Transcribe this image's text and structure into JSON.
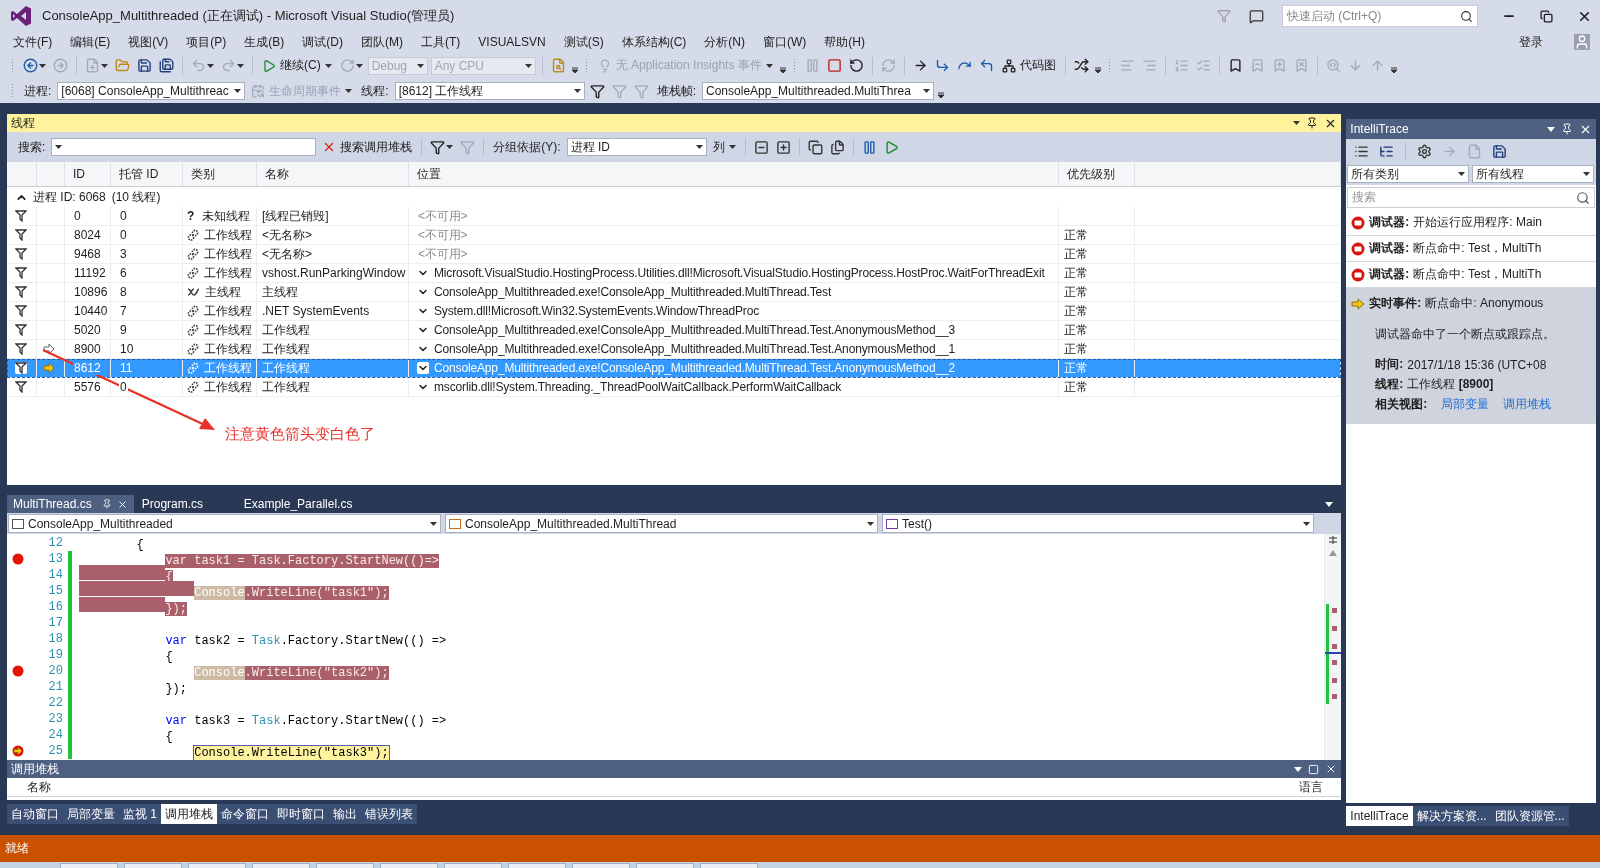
{
  "window": {
    "title": "ConsoleApp_Multithreaded (正在调试) - Microsoft Visual Studio(管理员)",
    "quick_launch": {
      "placeholder": "快速启动 (Ctrl+Q)"
    }
  },
  "menu": {
    "items": [
      "文件(F)",
      "编辑(E)",
      "视图(V)",
      "项目(P)",
      "生成(B)",
      "调试(D)",
      "团队(M)",
      "工具(T)",
      "VISUALSVN",
      "测试(S)",
      "体系结构(C)",
      "分析(N)",
      "窗口(W)",
      "帮助(H)"
    ],
    "sign_in": "登录"
  },
  "toolbar_main": [
    {
      "kind": "grip"
    },
    {
      "kind": "icon",
      "menu": true,
      "disabled": false
    },
    {
      "kind": "icon",
      "disabled": true
    },
    {
      "kind": "separator"
    },
    {
      "kind": "icon",
      "menu": true,
      "disabled": true
    },
    {
      "kind": "icon",
      "disabled": false
    },
    {
      "kind": "icon",
      "disabled": false
    },
    {
      "kind": "icon",
      "disabled": false
    },
    {
      "kind": "separator"
    },
    {
      "kind": "icon",
      "menu": true,
      "disabled": true
    },
    {
      "kind": "icon",
      "menu": true,
      "disabled": true
    },
    {
      "kind": "separator"
    },
    {
      "kind": "icon",
      "label": "继续(C)",
      "menu": true,
      "disabled": false
    },
    {
      "kind": "icon",
      "menu": true,
      "disabled": true
    },
    {
      "kind": "combo",
      "value": "Debug",
      "disabled": true
    },
    {
      "kind": "combo",
      "value": "Any CPU",
      "disabled": true
    },
    {
      "kind": "separator"
    },
    {
      "kind": "icon",
      "disabled": false
    },
    {
      "kind": "overflow"
    },
    {
      "kind": "grip"
    },
    {
      "kind": "icon",
      "label": "无 Application Insights 事件",
      "menu": true,
      "disabled": true
    },
    {
      "kind": "overflow"
    },
    {
      "kind": "grip"
    },
    {
      "kind": "icon",
      "disabled": true
    },
    {
      "kind": "icon",
      "disabled": false
    },
    {
      "kind": "icon",
      "disabled": false
    },
    {
      "kind": "separator"
    },
    {
      "kind": "icon",
      "disabled": true
    },
    {
      "kind": "separator"
    },
    {
      "kind": "icon",
      "disabled": false
    },
    {
      "kind": "icon",
      "disabled": false
    },
    {
      "kind": "icon",
      "disabled": false
    },
    {
      "kind": "icon",
      "disabled": false
    },
    {
      "kind": "icon",
      "label": "代码图",
      "disabled": false
    },
    {
      "kind": "separator"
    },
    {
      "kind": "icon",
      "disabled": false
    },
    {
      "kind": "overflow"
    },
    {
      "kind": "grip"
    },
    {
      "kind": "icon",
      "disabled": true
    },
    {
      "kind": "icon",
      "disabled": true
    },
    {
      "kind": "separator"
    },
    {
      "kind": "icon",
      "disabled": true
    },
    {
      "kind": "icon",
      "disabled": true
    },
    {
      "kind": "separator"
    },
    {
      "kind": "icon",
      "disabled": false
    },
    {
      "kind": "icon",
      "disabled": true
    },
    {
      "kind": "icon",
      "disabled": true
    },
    {
      "kind": "icon",
      "disabled": true
    },
    {
      "kind": "separator"
    },
    {
      "kind": "icon",
      "disabled": true
    },
    {
      "kind": "icon",
      "disabled": true
    },
    {
      "kind": "icon",
      "disabled": true
    },
    {
      "kind": "overflow"
    }
  ],
  "toolbar_debug": [
    {
      "kind": "grip"
    },
    {
      "kind": "label",
      "text": "进程:"
    },
    {
      "kind": "combo",
      "value": "[6068] ConsoleApp_Multithreac",
      "disabled": false
    },
    {
      "kind": "icon",
      "label": "生命周期事件",
      "menu": true,
      "disabled": true
    },
    {
      "kind": "label",
      "text": "线程:"
    },
    {
      "kind": "combo",
      "value": "[8612] 工作线程",
      "disabled": false
    },
    {
      "kind": "icon",
      "disabled": false
    },
    {
      "kind": "icon",
      "disabled": true
    },
    {
      "kind": "icon",
      "disabled": true
    },
    {
      "kind": "label",
      "text": "堆栈帧:"
    },
    {
      "kind": "combo",
      "value": "ConsoleApp_Multithreaded.MultiThrea",
      "disabled": false
    },
    {
      "kind": "overflow"
    }
  ],
  "threads": {
    "title": "线程",
    "toolbar": [
      {
        "kind": "label",
        "text": "搜索:"
      },
      {
        "kind": "combo",
        "disabled": false
      },
      {
        "kind": "icon",
        "label": "搜索调用堆栈",
        "disabled": false
      },
      {
        "kind": "separator"
      },
      {
        "kind": "icon",
        "menu": true,
        "disabled": false
      },
      {
        "kind": "icon",
        "disabled": true
      },
      {
        "kind": "separator"
      },
      {
        "kind": "label",
        "text": "分组依据(Y):"
      },
      {
        "kind": "combo",
        "value": "进程 ID",
        "disabled": false
      },
      {
        "kind": "menu_button",
        "label": "列"
      },
      {
        "kind": "separator"
      },
      {
        "kind": "icon",
        "disabled": false
      },
      {
        "kind": "icon",
        "disabled": false
      },
      {
        "kind": "separator"
      },
      {
        "kind": "icon",
        "disabled": false
      },
      {
        "kind": "icon",
        "disabled": false
      },
      {
        "kind": "separator"
      },
      {
        "kind": "icon",
        "disabled": false
      },
      {
        "kind": "icon",
        "disabled": false
      }
    ],
    "columns": [
      "ID",
      "托管 ID",
      "类别",
      "名称",
      "位置",
      "优先级别"
    ],
    "group": {
      "label": "进程 ID: 6068",
      "count": "(10 线程)",
      "expanded": true
    },
    "rows": [
      {
        "id": "0",
        "managed_id": "0",
        "kind": "unknown",
        "icon": "?",
        "category": "未知线程",
        "name": "[线程已销毁]",
        "location": "<不可用>",
        "expandable": false,
        "current": false,
        "previous": false,
        "selected": false
      },
      {
        "id": "8024",
        "managed_id": "0",
        "kind": "worker",
        "category": "工作线程",
        "name": "<无名称>",
        "location": "<不可用>",
        "expandable": false,
        "priority": "正常",
        "current": false,
        "previous": false,
        "selected": false
      },
      {
        "id": "9468",
        "managed_id": "3",
        "kind": "worker",
        "category": "工作线程",
        "name": "<无名称>",
        "location": "<不可用>",
        "expandable": false,
        "priority": "正常",
        "current": false,
        "previous": false,
        "selected": false
      },
      {
        "id": "11192",
        "managed_id": "6",
        "kind": "worker",
        "category": "工作线程",
        "name": "vshost.RunParkingWindow",
        "location": "Microsoft.VisualStudio.HostingProcess.Utilities.dll!Microsoft.VisualStudio.HostingProcess.HostProc.WaitForThreadExit",
        "expandable": true,
        "priority": "正常",
        "current": false,
        "previous": false,
        "selected": false
      },
      {
        "id": "10896",
        "managed_id": "8",
        "kind": "main",
        "category": "主线程",
        "name": "主线程",
        "location": "ConsoleApp_Multithreaded.exe!ConsoleApp_Multithreaded.MultiThread.Test",
        "expandable": true,
        "priority": "正常",
        "current": false,
        "previous": false,
        "selected": false
      },
      {
        "id": "10440",
        "managed_id": "7",
        "kind": "worker",
        "category": "工作线程",
        "name": ".NET SystemEvents",
        "location": "System.dll!Microsoft.Win32.SystemEvents.WindowThreadProc",
        "expandable": true,
        "priority": "正常",
        "current": false,
        "previous": false,
        "selected": false
      },
      {
        "id": "5020",
        "managed_id": "9",
        "kind": "worker",
        "category": "工作线程",
        "name": "工作线程",
        "location": "ConsoleApp_Multithreaded.exe!ConsoleApp_Multithreaded.MultiThread.Test.AnonymousMethod__3",
        "expandable": true,
        "priority": "正常",
        "current": false,
        "previous": false,
        "selected": false
      },
      {
        "id": "8900",
        "managed_id": "10",
        "kind": "worker",
        "category": "工作线程",
        "name": "工作线程",
        "location": "ConsoleApp_Multithreaded.exe!ConsoleApp_Multithreaded.MultiThread.Test.AnonymousMethod__1",
        "expandable": true,
        "priority": "正常",
        "current": false,
        "previous": true,
        "selected": false
      },
      {
        "id": "8612",
        "managed_id": "11",
        "kind": "worker",
        "category": "工作线程",
        "name": "工作线程",
        "location": "ConsoleApp_Multithreaded.exe!ConsoleApp_Multithreaded.MultiThread.Test.AnonymousMethod__2",
        "expandable": true,
        "priority": "正常",
        "current": true,
        "previous": false,
        "selected": true
      },
      {
        "id": "5576",
        "managed_id": "0",
        "kind": "worker",
        "category": "工作线程",
        "name": "工作线程",
        "location": "mscorlib.dll!System.Threading._ThreadPoolWaitCallback.PerformWaitCallback",
        "expandable": true,
        "priority": "正常",
        "current": false,
        "previous": false,
        "selected": false
      }
    ],
    "annotation": {
      "text": "注意黄色箭头变白色了"
    }
  },
  "editor": {
    "tabs": [
      {
        "label": "MultiThread.cs",
        "selected": true,
        "pinned": true
      },
      {
        "label": "Program.cs",
        "selected": false,
        "pinned": false
      },
      {
        "label": "Example_Parallel.cs",
        "selected": false,
        "pinned": false
      }
    ],
    "navigation": [
      "ConsoleApp_Multithreaded",
      "ConsoleApp_Multithreaded.MultiThread",
      "Test()"
    ],
    "lines": [
      {
        "number": "12",
        "kind": "outer",
        "breakpoint": false,
        "current": false,
        "changed": false,
        "marked": false,
        "segments": [
          {
            "text": "{",
            "kind": "plain"
          }
        ]
      },
      {
        "number": "13",
        "kind": "inner",
        "breakpoint": true,
        "current": false,
        "changed": true,
        "marked": false,
        "segments": [
          {
            "text": "var task1 = Task.Factory.StartNew(()=>",
            "kind": "breakpoint"
          }
        ]
      },
      {
        "number": "14",
        "kind": "inner",
        "breakpoint": false,
        "current": false,
        "changed": true,
        "marked": true,
        "segments": [
          {
            "text": "{",
            "kind": "breakpoint"
          }
        ]
      },
      {
        "number": "15",
        "kind": "nested",
        "breakpoint": false,
        "current": false,
        "changed": true,
        "marked": true,
        "segments": [
          {
            "text": "Console",
            "kind": "token"
          },
          {
            "text": ".WriteLine(\"task1\");",
            "kind": "breakpoint"
          }
        ]
      },
      {
        "number": "16",
        "kind": "inner",
        "breakpoint": false,
        "current": false,
        "changed": true,
        "marked": true,
        "segments": [
          {
            "text": "});",
            "kind": "breakpoint"
          }
        ]
      },
      {
        "number": "17",
        "breakpoint": false,
        "current": false,
        "changed": true
      },
      {
        "number": "18",
        "kind": "inner",
        "breakpoint": false,
        "current": false,
        "changed": true,
        "marked": false,
        "segments": [
          {
            "text": "var",
            "kind": "keyword"
          },
          {
            "text": " task2 = ",
            "kind": "plain"
          },
          {
            "text": "Task",
            "kind": "type"
          },
          {
            "text": ".Factory.StartNew(() =>",
            "kind": "plain"
          }
        ]
      },
      {
        "number": "19",
        "kind": "inner",
        "breakpoint": false,
        "current": false,
        "changed": true,
        "marked": false,
        "segments": [
          {
            "text": "{",
            "kind": "plain"
          }
        ]
      },
      {
        "number": "20",
        "kind": "nested",
        "breakpoint": true,
        "current": false,
        "changed": true,
        "marked": false,
        "segments": [
          {
            "text": "Console",
            "kind": "token"
          },
          {
            "text": ".WriteLine(\"task2\");",
            "kind": "breakpoint"
          }
        ]
      },
      {
        "number": "21",
        "kind": "inner",
        "breakpoint": false,
        "current": false,
        "changed": true,
        "marked": false,
        "segments": [
          {
            "text": "});",
            "kind": "plain"
          }
        ]
      },
      {
        "number": "22",
        "breakpoint": false,
        "current": false,
        "changed": true
      },
      {
        "number": "23",
        "kind": "inner",
        "breakpoint": false,
        "current": false,
        "changed": true,
        "marked": false,
        "segments": [
          {
            "text": "var",
            "kind": "keyword"
          },
          {
            "text": " task3 = ",
            "kind": "plain"
          },
          {
            "text": "Task",
            "kind": "type"
          },
          {
            "text": ".Factory.StartNew(() =>",
            "kind": "plain"
          }
        ]
      },
      {
        "number": "24",
        "kind": "inner",
        "breakpoint": false,
        "current": false,
        "changed": true,
        "marked": false,
        "segments": [
          {
            "text": "{",
            "kind": "plain"
          }
        ]
      },
      {
        "number": "25",
        "kind": "nested",
        "breakpoint": true,
        "current": true,
        "changed": true,
        "marked": false,
        "segments": [
          {
            "text": "Console.WriteLine(\"task3\");",
            "kind": "current"
          }
        ]
      }
    ]
  },
  "call_stack": {
    "title": "调用堆栈",
    "columns": [
      "名称",
      "语言"
    ]
  },
  "bottom_tabs": [
    {
      "label": "自动窗口",
      "selected": false
    },
    {
      "label": "局部变量",
      "selected": false
    },
    {
      "label": "监视 1",
      "selected": false
    },
    {
      "label": "调用堆栈",
      "selected": true
    },
    {
      "label": "命令窗口",
      "selected": false
    },
    {
      "label": "即时窗口",
      "selected": false
    },
    {
      "label": "输出",
      "selected": false
    },
    {
      "label": "错误列表",
      "selected": false
    }
  ],
  "intellitrace": {
    "title": "IntelliTrace",
    "toolbar": [
      {
        "kind": "icon",
        "disabled": false
      },
      {
        "kind": "icon",
        "disabled": false
      },
      {
        "kind": "separator"
      },
      {
        "kind": "icon",
        "disabled": false
      },
      {
        "kind": "icon",
        "disabled": true
      },
      {
        "kind": "icon",
        "disabled": true
      },
      {
        "kind": "icon",
        "disabled": false
      }
    ],
    "filters": [
      "所有类别",
      "所有线程"
    ],
    "search": {
      "placeholder": "搜索"
    },
    "events": [
      {
        "kind": "debugger",
        "label": "调试器:",
        "text": "开始运行应用程序: Main",
        "selected": false
      },
      {
        "kind": "debugger",
        "label": "调试器:",
        "text": "断点命中: Test，MultiTh",
        "selected": false
      },
      {
        "kind": "debugger",
        "label": "调试器:",
        "text": "断点命中: Test，MultiTh",
        "selected": false
      },
      {
        "kind": "live",
        "label": "实时事件:",
        "text": "断点命中: Anonymous",
        "selected": true,
        "description": "调试器命中了一个断点或跟踪点。",
        "fields": [
          {
            "label": "时间:",
            "value": "2017/1/18 15:36 (UTC+08"
          },
          {
            "label": "线程:",
            "value": "工作线程 **[8900]**"
          }
        ],
        "related_label": "相关视图:",
        "links": [
          "局部变量",
          "调用堆栈"
        ]
      }
    ]
  },
  "side_tabs": [
    {
      "label": "IntelliTrace",
      "selected": true
    },
    {
      "label": "解决方案资...",
      "selected": false
    },
    {
      "label": "团队资源管...",
      "selected": false
    }
  ],
  "status_bar": {
    "text": "就绪"
  }
}
